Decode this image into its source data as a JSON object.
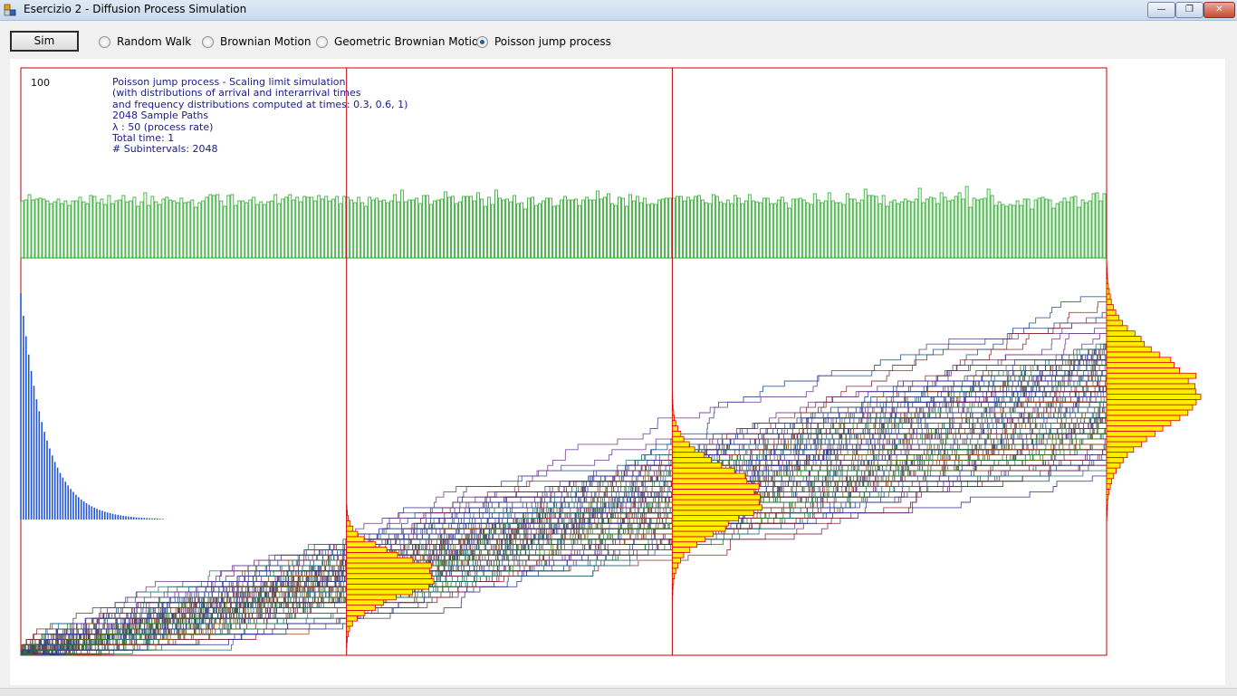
{
  "window": {
    "title": "Esercizio 2 - Diffusion Process Simulation",
    "minimize_glyph": "—",
    "restore_glyph": "❐",
    "close_glyph": "✕",
    "icon": "app-icon"
  },
  "toolbar": {
    "sim_label": "Sim",
    "options": [
      {
        "label": "Random Walk",
        "checked": false
      },
      {
        "label": "Brownian Motion",
        "checked": false
      },
      {
        "label": "Geometric Brownian Motion",
        "checked": false
      },
      {
        "label": "Poisson jump process",
        "checked": true
      }
    ]
  },
  "plot": {
    "counter": "100",
    "info_lines": [
      "Poisson jump process - Scaling limit simulation",
      "(with distributions of arrival and interarrival times",
      "and frequency distributions computed at times: 0.3, 0.6, 1)",
      "2048 Sample Paths",
      "λ : 50 (process rate)",
      "Total time: 1",
      "# Subintervals: 2048"
    ],
    "colors": {
      "frame": "#c00000",
      "time_markers": "#c00000",
      "arrival_bars": "#22aa22",
      "interarrival_bars": "#2255dd",
      "histogram_fill": "#ffee00",
      "histogram_stroke": "#dd0000"
    },
    "lambda": 50,
    "total_time": 1,
    "sample_paths": 2048,
    "subintervals": 2048,
    "observation_times": [
      0.3,
      0.6,
      1
    ]
  }
}
